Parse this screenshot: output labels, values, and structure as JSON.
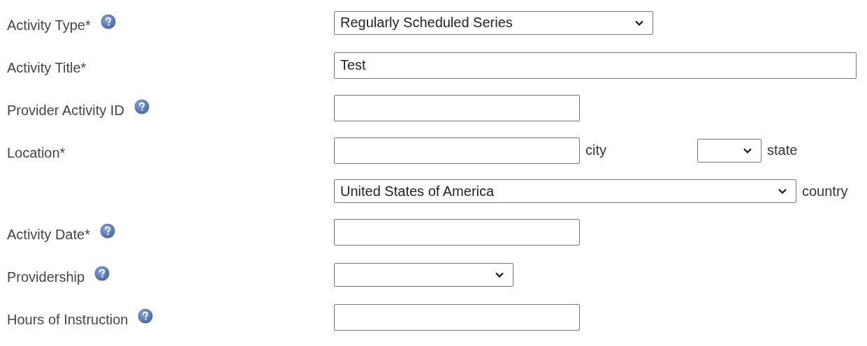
{
  "form": {
    "rows": [
      {
        "label": "Activity Type*",
        "help": true,
        "controls": [
          {
            "kind": "select",
            "value": "Regularly Scheduled Series"
          }
        ]
      },
      {
        "label": "Activity Title*",
        "help": false,
        "controls": [
          {
            "kind": "input",
            "value": "Test"
          }
        ]
      },
      {
        "label": "Provider Activity ID",
        "help": true,
        "controls": [
          {
            "kind": "input"
          }
        ]
      },
      {
        "label": "Location*",
        "help": false,
        "controls": [
          {
            "kind": "input",
            "suffix": "city"
          },
          {
            "kind": "select",
            "suffix": "state"
          }
        ]
      },
      {
        "help": false,
        "controls": [
          {
            "kind": "select",
            "value": "United States of America",
            "suffix": "country"
          }
        ]
      },
      {
        "label": "Activity Date*",
        "help": true,
        "controls": [
          {
            "kind": "input"
          }
        ]
      },
      {
        "label": "Providership",
        "help": true,
        "controls": [
          {
            "kind": "select"
          }
        ]
      },
      {
        "label": "Hours of Instruction",
        "help": true,
        "controls": [
          {
            "kind": "input"
          }
        ]
      }
    ]
  }
}
